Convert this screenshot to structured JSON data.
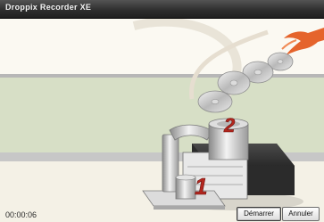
{
  "window": {
    "title": "Droppix Recorder XE"
  },
  "status": {
    "elapsed_time": "00:00:06"
  },
  "illustration": {
    "step_1": "1",
    "step_2": "2",
    "colors": {
      "accent_orange": "#e5642c",
      "step_red": "#b3261e",
      "band_green": "#d7dfc6",
      "band_grey": "#c7c7c7"
    }
  },
  "buttons": {
    "start_label": "Démarrer",
    "cancel_label": "Annuler"
  }
}
